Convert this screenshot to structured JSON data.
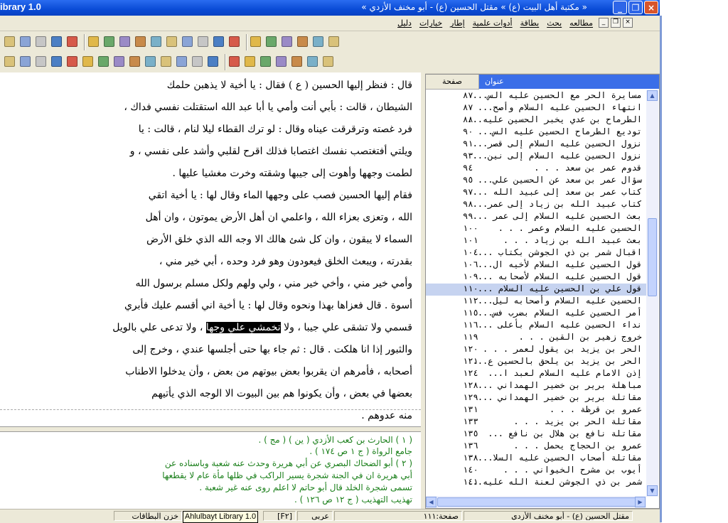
{
  "window": {
    "app_title": "ibrary 1.0",
    "title": "« مكتبة أهل البيت (ع) » مقتل الحسين (ع) - أبو مخنف الأزدي »",
    "minimize_label": "_",
    "restore_label": "❐",
    "close_label": "×"
  },
  "menu": {
    "items": [
      "مطالعه",
      "بحث",
      "بطاقة",
      "أدوات علمية",
      "إطار",
      "خيارات",
      "دليل"
    ]
  },
  "toolbar_icons_row1": [
    "copy-icon",
    "info-icon",
    "columns-icon",
    "layout-icon",
    "list-icon",
    "binoculars-icon",
    "check-icon",
    "find-replace-icon",
    "font-mark-icon",
    "font-mark-2-icon",
    "eraser-icon",
    "arrows-icon",
    "arrow-back-icon",
    "mark-icon",
    "mark-next-icon",
    "folder-icon",
    "folder-star-icon",
    "book-back-icon",
    "book-next-icon",
    "book-stack-icon",
    "book-end-icon"
  ],
  "toolbar_icons_row2": [
    "pencil-icon",
    "globe-icon",
    "note-icon",
    "picture-icon",
    "star-frame-icon",
    "text-frame-icon",
    "ink-icon",
    "feather-icon",
    "feather-mark-icon",
    "hand-icon",
    "dots-icon",
    "hand-2-icon",
    "left-arrow-icon",
    "right-arrow-icon",
    "grip-icon",
    "window-cascade-icon",
    "window-new-icon",
    "window-close-icon",
    "window-tile-icon",
    "split-h-icon",
    "split-v-icon"
  ],
  "text": {
    "lines": [
      "قال : فنظر إليها الحسين ( ع ) فقال : يا أخية لا يذهبن حلمك",
      "الشيطان ، قالت : بأبي أنت وأمي يا أبا عبد الله استقتلت نفسي فداك ،",
      "فرد غصته وترقرقت عيناه وقال : لو ترك القطاء ليلا لنام ، قالت : يا",
      "ويلتي أفتغتصب نفسك اغتصابا فذلك اقرح لقلبي وأشد على نفسي ، و",
      "لطمت وجهها وأهوت إلى جيبها وشقته وخرت مغشيا عليها .",
      "فقام إليها الحسين فصب على وجهها الماء وقال لها : يا أخية اتقي",
      "الله ، وتعزى بعزاء الله ، واعلمي ان أهل الأرض يموتون ، وان أهل",
      "السماء لا يبقون ، وان كل شئ هالك الا وجه الله الذي خلق الأرض",
      "بقدرته ، ويبعث الخلق فيعودون وهو فرد وحده ، أبي خير مني ،",
      "وأمي خير مني ، وأخي خير مني ، ولي ولهم ولكل مسلم برسول الله",
      "أسوة . قال فعزاها بهذا ونحوه وقال لها : يا أخية اني أقسم عليك فأبري",
      "قسمي ولا تشقى علي جيبا ، ولا",
      "والثبور إذا انا هلكت . قال : ثم جاء بها حتى أجلسها عندي ، وخرج إلى",
      "أصحابه ، فأمرهم ان يقربوا بعض بيوتهم من بعض ، وأن يدخلوا الاطناب",
      "بعضها في بعض ، وأن يكونوا هم بين البيوت الا الوجه الذي يأتيهم",
      "منه عدوهم ."
    ],
    "line12_highlight": "تخمشي علي وجها",
    "line12_tail": "، ولا تدعى علي بالويل"
  },
  "footnotes": {
    "lines": [
      "( ١ ) الحارث بن كعب الأزدي ( ين ) ( مج ) .",
      "جامع الرواة ( ج ١ ص ١٧٤ ) .",
      "( ٢ ) أبو الضحاك البصري عن أبي هريرة وحدث عنه شعبة وباسناده عن",
      "أبي هريرة ان في الجنة شجرة يسير الراكب في ظلها مأة عام لا يقطعها",
      "تسمى شجرة الخلد قال أبو حاتم لا اعلم روى عنه غير شعبة .",
      "تهذيب التهذيب ( ج ١٢ ص ١٢٦ ) ."
    ]
  },
  "toc": {
    "col_title": "عنوان",
    "col_page": "صفحة",
    "rows": [
      {
        "title": "مسايرة الحر مع الحسين عليه الس...",
        "page": "٨٧"
      },
      {
        "title": "انتهاء الحسين عليه السلام وأصح...",
        "page": "٨٧"
      },
      {
        "title": "الطرماح بن عدي يخبر الحسين عليه...",
        "page": "٨٨"
      },
      {
        "title": "توديع الطرماح الحسين عليه الس...",
        "page": "٩٠"
      },
      {
        "title": "نزول الحسين عليه السلام إلى قصر...",
        "page": "٩١"
      },
      {
        "title": "نزول الحسين عليه السلام إلى نين...",
        "page": "٩٣"
      },
      {
        "title": "قدوم عمر بن سعد . . .",
        "page": "٩٤"
      },
      {
        "title": "سؤال عمر بن سعد عن الحسين علي...",
        "page": "٩٥"
      },
      {
        "title": "كتاب عمر بن سعد إلى عبيد الله ...",
        "page": "٩٧"
      },
      {
        "title": "كتاب عبيد الله بن زياد إلى عمر...",
        "page": "٩٨"
      },
      {
        "title": "بعث الحسين عليه السلام إلى عمر ...",
        "page": "٩٩"
      },
      {
        "title": "الحسين عليه السلام وعمر . . .",
        "page": "١٠٠"
      },
      {
        "title": "بعث عبيد الله بن زياد . . .",
        "page": "١٠١"
      },
      {
        "title": "اقبال شمر بن ذي الجوشن بكتاب ...",
        "page": "١٠٤"
      },
      {
        "title": "قول الحسين عليه السلام لأخيه ال...",
        "page": "١٠٦"
      },
      {
        "title": "قول الحسين عليه السلام لأصحابه ...",
        "page": "١٠٩"
      },
      {
        "title": "قول علي بن الحسين عليه السلام ...",
        "page": "١١٠"
      },
      {
        "title": "الحسين عليه السلام وأصحابه ليل...",
        "page": "١١٢"
      },
      {
        "title": "أمر الحسين عليه السلام بضرب فس...",
        "page": "١١٥"
      },
      {
        "title": "نداء الحسين عليه السلام بأعلى ...",
        "page": "١١٦"
      },
      {
        "title": "خروج زهير بن القين . . .",
        "page": "١١٩"
      },
      {
        "title": "الحر بن يزيد بن يقول لعمر . . .",
        "page": "١٢٠"
      },
      {
        "title": "الحر بن يزيد بن يلحق بالحسين ع...",
        "page": "١٢١"
      },
      {
        "title": "إذن الامام عليه السلام لعبد ا...",
        "page": "١٢٤"
      },
      {
        "title": "مباهلة برير بن خضير الهمداني ...",
        "page": "١٢٨"
      },
      {
        "title": "مقاتلة برير بن خضير الهمداني ...",
        "page": "١٢٩"
      },
      {
        "title": "عمرو بن قرظة . . .",
        "page": "١٣١"
      },
      {
        "title": "مقاتلة الحر بن يزيد . . .",
        "page": "١٣٣"
      },
      {
        "title": "مقاتلة نافع بن هلال بن نافع ...",
        "page": "١٣٥"
      },
      {
        "title": "عمرو بن الحجاج يحمل . . .",
        "page": "١٣٦"
      },
      {
        "title": "مقاتلة أصحاب الحسين عليه السلا...",
        "page": "١٣٨"
      },
      {
        "title": "أيوب بن مشرح الخيواني . . .",
        "page": "١٤٠"
      },
      {
        "title": "شمر بن ذي الجوشن لعنة الله عليه...",
        "page": "١٤١"
      }
    ],
    "selected_index": 16
  },
  "status": {
    "book": "مقتل الحسين (ع) - أبو مخنف الأزدي",
    "page": "صفحة:١١١",
    "lang": "عربي",
    "code": "[F٢]",
    "tooltip": "Ahlulbayt Library 1.0",
    "cards": "خزن البطاقات"
  },
  "colors": {
    "titlebar": "#0a4bd6",
    "toc_header": "#3a6ee8",
    "selection": "#c6d3f0",
    "footnote": "#1a7f1a"
  }
}
